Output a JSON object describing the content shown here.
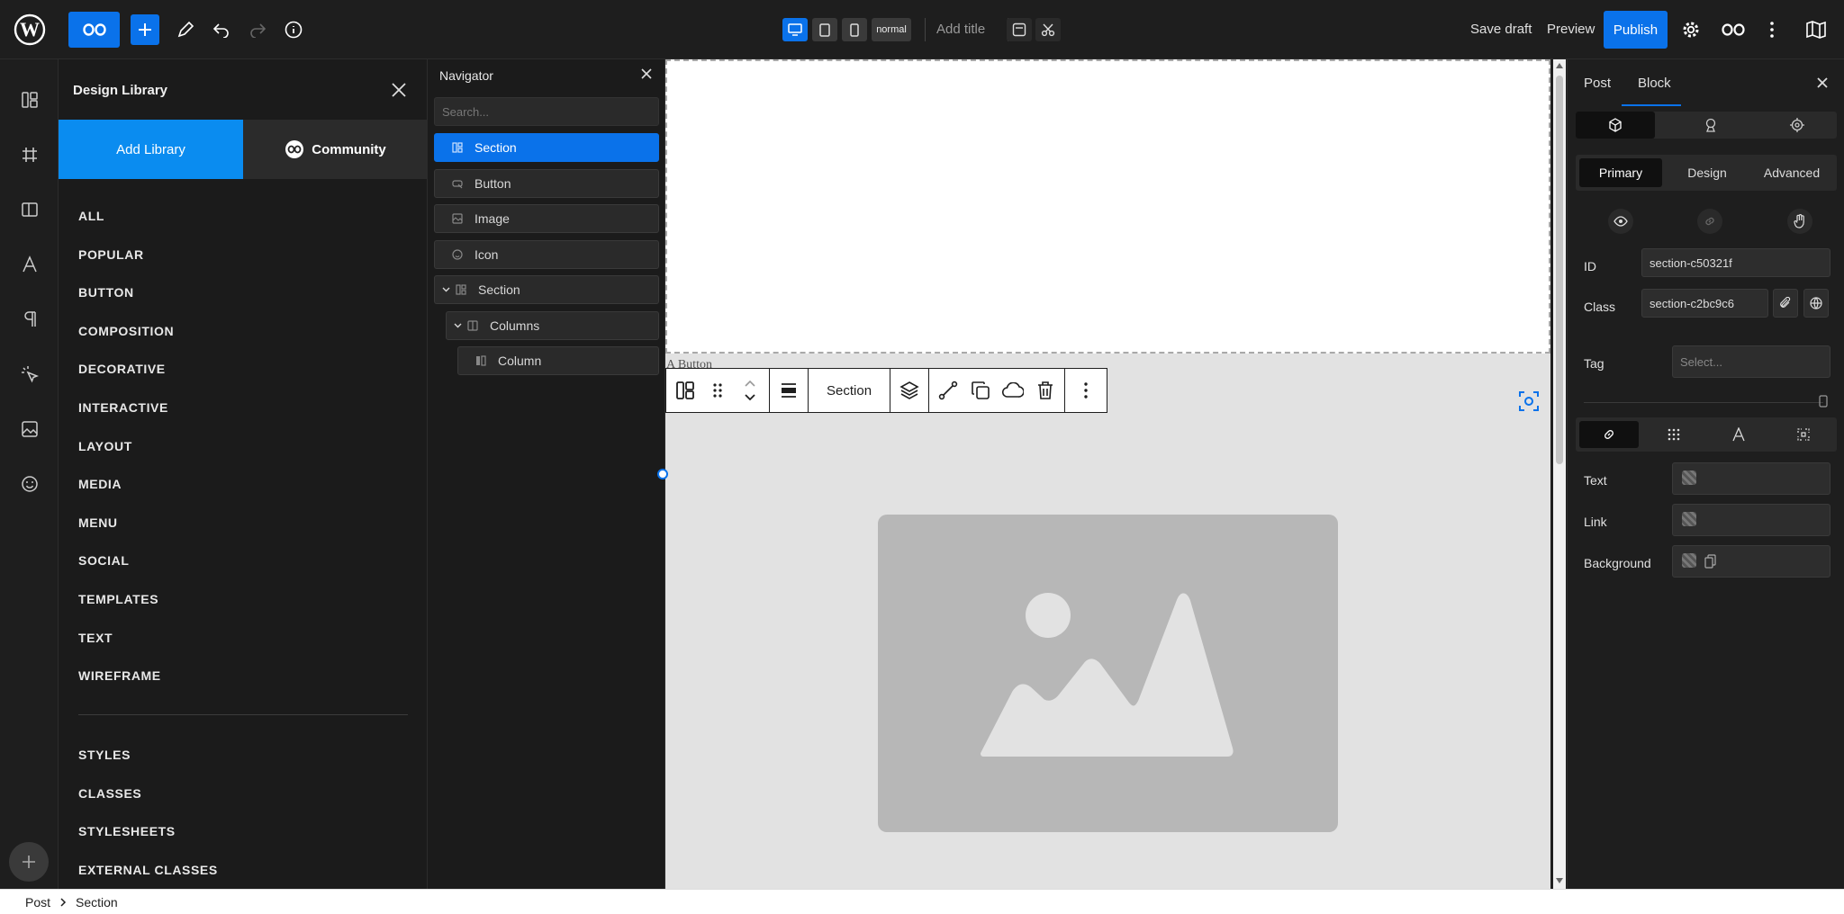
{
  "topbar": {
    "device_mode": "normal",
    "add_title": "Add title",
    "save_draft": "Save draft",
    "preview": "Preview",
    "publish": "Publish"
  },
  "library": {
    "title": "Design Library",
    "tabs": {
      "add_library": "Add Library",
      "community": "Community"
    },
    "categories": [
      "ALL",
      "POPULAR",
      "BUTTON",
      "COMPOSITION",
      "DECORATIVE",
      "INTERACTIVE",
      "LAYOUT",
      "MEDIA",
      "MENU",
      "SOCIAL",
      "TEMPLATES",
      "TEXT",
      "WIREFRAME"
    ],
    "extras": [
      "STYLES",
      "CLASSES",
      "STYLESHEETS",
      "EXTERNAL CLASSES"
    ]
  },
  "navigator": {
    "title": "Navigator",
    "search_placeholder": "Search...",
    "items": [
      {
        "label": "Section",
        "icon": "section-icon",
        "level": 0,
        "active": true,
        "caret": false
      },
      {
        "label": "Button",
        "icon": "button-icon",
        "level": 0,
        "active": false,
        "caret": false
      },
      {
        "label": "Image",
        "icon": "image-icon",
        "level": 0,
        "active": false,
        "caret": false
      },
      {
        "label": "Icon",
        "icon": "smiley-icon",
        "level": 0,
        "active": false,
        "caret": false
      },
      {
        "label": "Section",
        "icon": "section-icon",
        "level": 0,
        "active": false,
        "caret": true
      },
      {
        "label": "Columns",
        "icon": "columns-icon",
        "level": 1,
        "active": false,
        "caret": true
      },
      {
        "label": "Column",
        "icon": "column-icon",
        "level": 2,
        "active": false,
        "caret": false
      }
    ]
  },
  "canvas": {
    "button_text": "A Button",
    "toolbar_label": "Section"
  },
  "inspector": {
    "tabs": {
      "post": "Post",
      "block": "Block"
    },
    "sub_tabs": {
      "primary": "Primary",
      "design": "Design",
      "advanced": "Advanced"
    },
    "id_label": "ID",
    "id_value": "section-c50321f",
    "class_label": "Class",
    "class_value": "section-c2bc9c6",
    "tag_label": "Tag",
    "tag_placeholder": "Select...",
    "colors": {
      "text": "Text",
      "link": "Link",
      "background": "Background"
    }
  },
  "statusbar": {
    "crumbs": [
      "Post",
      "Section"
    ]
  },
  "colors": {
    "accent": "#0a72ea",
    "panel": "#1e1e1e",
    "canvas_bg": "#e2e2e2",
    "placeholder": "#b7b7b7"
  }
}
